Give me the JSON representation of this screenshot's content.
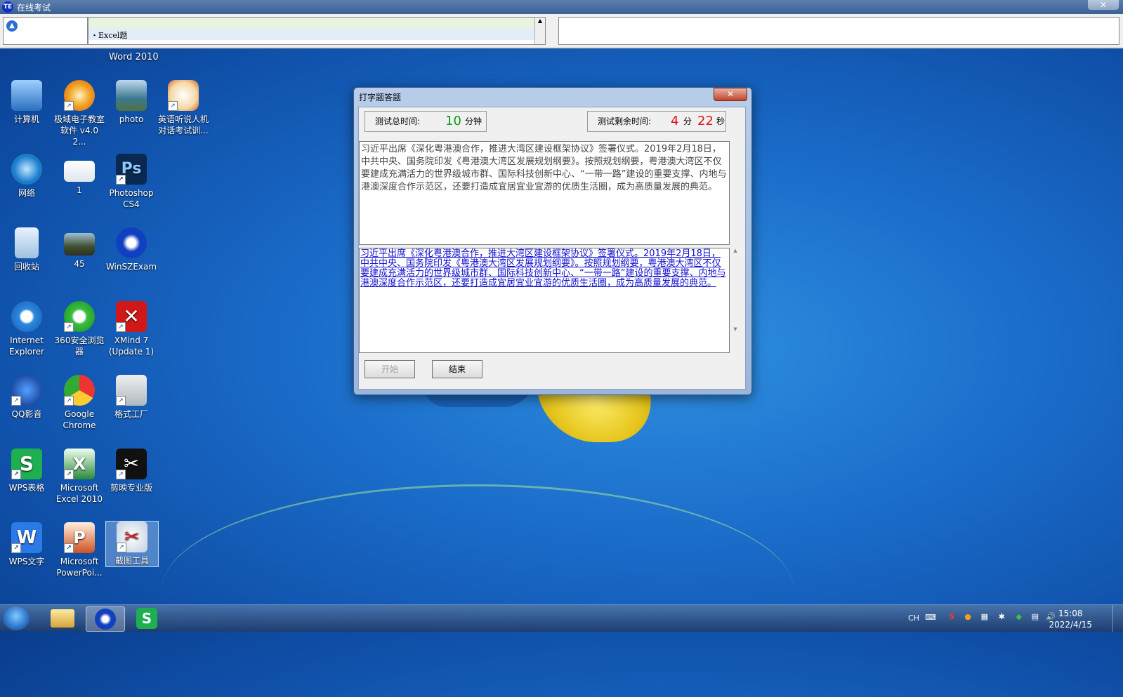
{
  "window": {
    "title": "在线考试",
    "close_label": "✕"
  },
  "top_panel": {
    "question_item": "・Excel题",
    "scroll_up": "▲"
  },
  "desktop_icons": [
    {
      "label": "计算机"
    },
    {
      "label": "极域电子教室\n软件 v4.0 2..."
    },
    {
      "label": "photo"
    },
    {
      "label": "英语听说人机\n对话考试训..."
    },
    {
      "label": "网络"
    },
    {
      "label": "1"
    },
    {
      "label": "Photoshop\nCS4"
    },
    {
      "label": "回收站"
    },
    {
      "label": "45"
    },
    {
      "label": "WinSZExam"
    },
    {
      "label": "Internet\nExplorer"
    },
    {
      "label": "360安全浏览\n器"
    },
    {
      "label": "XMind 7\n(Update 1)"
    },
    {
      "label": "QQ影音"
    },
    {
      "label": "Google\nChrome"
    },
    {
      "label": "格式工厂"
    },
    {
      "label": "WPS表格"
    },
    {
      "label": "Microsoft\nExcel 2010"
    },
    {
      "label": "剪映专业版"
    },
    {
      "label": "WPS文字"
    },
    {
      "label": "Microsoft\nPowerPoi..."
    },
    {
      "label": "截图工具"
    }
  ],
  "partial_label": "Word 2010",
  "dialog": {
    "title": "打字题答题",
    "close_label": "✕",
    "total_time_label": "测试总时间:",
    "total_time_value": "10",
    "total_time_unit": "分钟",
    "remaining_label": "测试剩余时间:",
    "remaining_min": "4",
    "min_unit": "分",
    "remaining_sec": "22",
    "sec_unit": "秒",
    "reference_text": "习近平出席《深化粤港澳合作，推进大湾区建设框架协议》签署仪式。2019年2月18日，中共中央、国务院印发《粤港澳大湾区发展规划纲要》。按照规划纲要，粤港澳大湾区不仅要建成充满活力的世界级城市群、国际科技创新中心、“一带一路”建设的重要支撑、内地与港澳深度合作示范区，还要打造成宜居宜业宜游的优质生活圈，成为高质量发展的典范。",
    "typed_text": "习近平出席《深化粤港澳合作，推进大湾区建设框架协议》签署仪式。2019年2月18日，中共中央、国务院印发《粤港澳大湾区发展规划纲要》。按照规划纲要，粤港澳大湾区不仅要建成充满活力的世界级城市群、国际科技创新中心、“一带一路”建设的重要支撑、内地与港澳深度合作示范区，还要打造成宜居宜业宜游的优质生活圈，成为高质量发展的典范。",
    "start_label": "开始",
    "end_label": "结束"
  },
  "taskbar": {
    "ime": "CH",
    "time": "15:08",
    "date": "2022/4/15"
  }
}
